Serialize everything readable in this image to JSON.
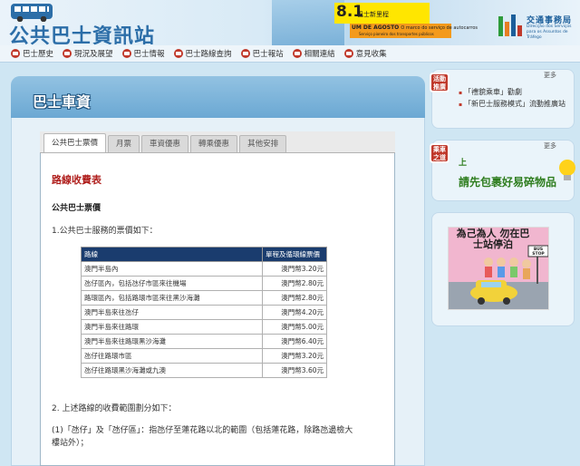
{
  "header": {
    "site_title": "公共巴士資訊站",
    "promo_number": "8.1",
    "promo_label": "巴士新里程",
    "promo_orange_title": "UM DE AGOSTO",
    "promo_orange_text": "O marco do serviço de autocarros",
    "promo_orange_sub": "Serviço pioneiro dos transportes públicos",
    "agency_name": "交通事務局",
    "agency_sub": "Direcção dos Serviços para os Assuntos de Tráfego"
  },
  "nav": {
    "items": [
      {
        "label": "巴士歷史"
      },
      {
        "label": "現況及展望"
      },
      {
        "label": "巴士情報"
      },
      {
        "label": "巴士路線查詢"
      },
      {
        "label": "巴士報站"
      },
      {
        "label": "相關連結"
      },
      {
        "label": "意見收集"
      }
    ]
  },
  "main": {
    "panel_title": "巴士車資",
    "tabs": [
      {
        "label": "公共巴士票價"
      },
      {
        "label": "月票"
      },
      {
        "label": "車資優惠"
      },
      {
        "label": "轉乘優惠"
      },
      {
        "label": "其他安排"
      }
    ],
    "section_title": "路線收費表",
    "sub_title": "公共巴士票價",
    "intro": "1.公共巴士服務的票價如下：",
    "table": {
      "headers": [
        "路線",
        "單程及循環線票價"
      ],
      "rows": [
        [
          "澳門半島內",
          "澳門幣3.20元"
        ],
        [
          "氹仔區內，包括氹仔市區來往機場",
          "澳門幣2.80元"
        ],
        [
          "路環區內，包括路環市區來往黑沙海灘",
          "澳門幣2.80元"
        ],
        [
          "澳門半島來往氹仔",
          "澳門幣4.20元"
        ],
        [
          "澳門半島來往路環",
          "澳門幣5.00元"
        ],
        [
          "澳門半島來往路環黑沙海灘",
          "澳門幣6.40元"
        ],
        [
          "氹仔往路環市區",
          "澳門幣3.20元"
        ],
        [
          "氹仔往路環黑沙海灘或九澳",
          "澳門幣3.60元"
        ]
      ]
    },
    "para2": "2. 上述路線的收費範圍劃分如下：",
    "para3_line1": "(1)「氹仔」及「氹仔區」：指氹仔至蓮花路以北的範圍（包括蓮花路，除路氹邊檢大",
    "para3_line2": "樓站外）；"
  },
  "sidebar": {
    "box1_badge": "活動推廣",
    "box1_more": "更多",
    "box1_items": [
      "「禮貌乘車」勸劇",
      "「新巴士服務模式」流動推廣站"
    ],
    "box2_badge": "乘車之道",
    "box2_more": "更多",
    "slogan_top": "上",
    "slogan": "請先包裹好易碎物品",
    "poster_title": "為己為人 勿在巴士站停泊",
    "poster_sign": "BUS STOP"
  },
  "colors": {
    "accent_red": "#b0201e",
    "table_header": "#1a3c6e",
    "brand_blue": "#2c6ea8"
  }
}
